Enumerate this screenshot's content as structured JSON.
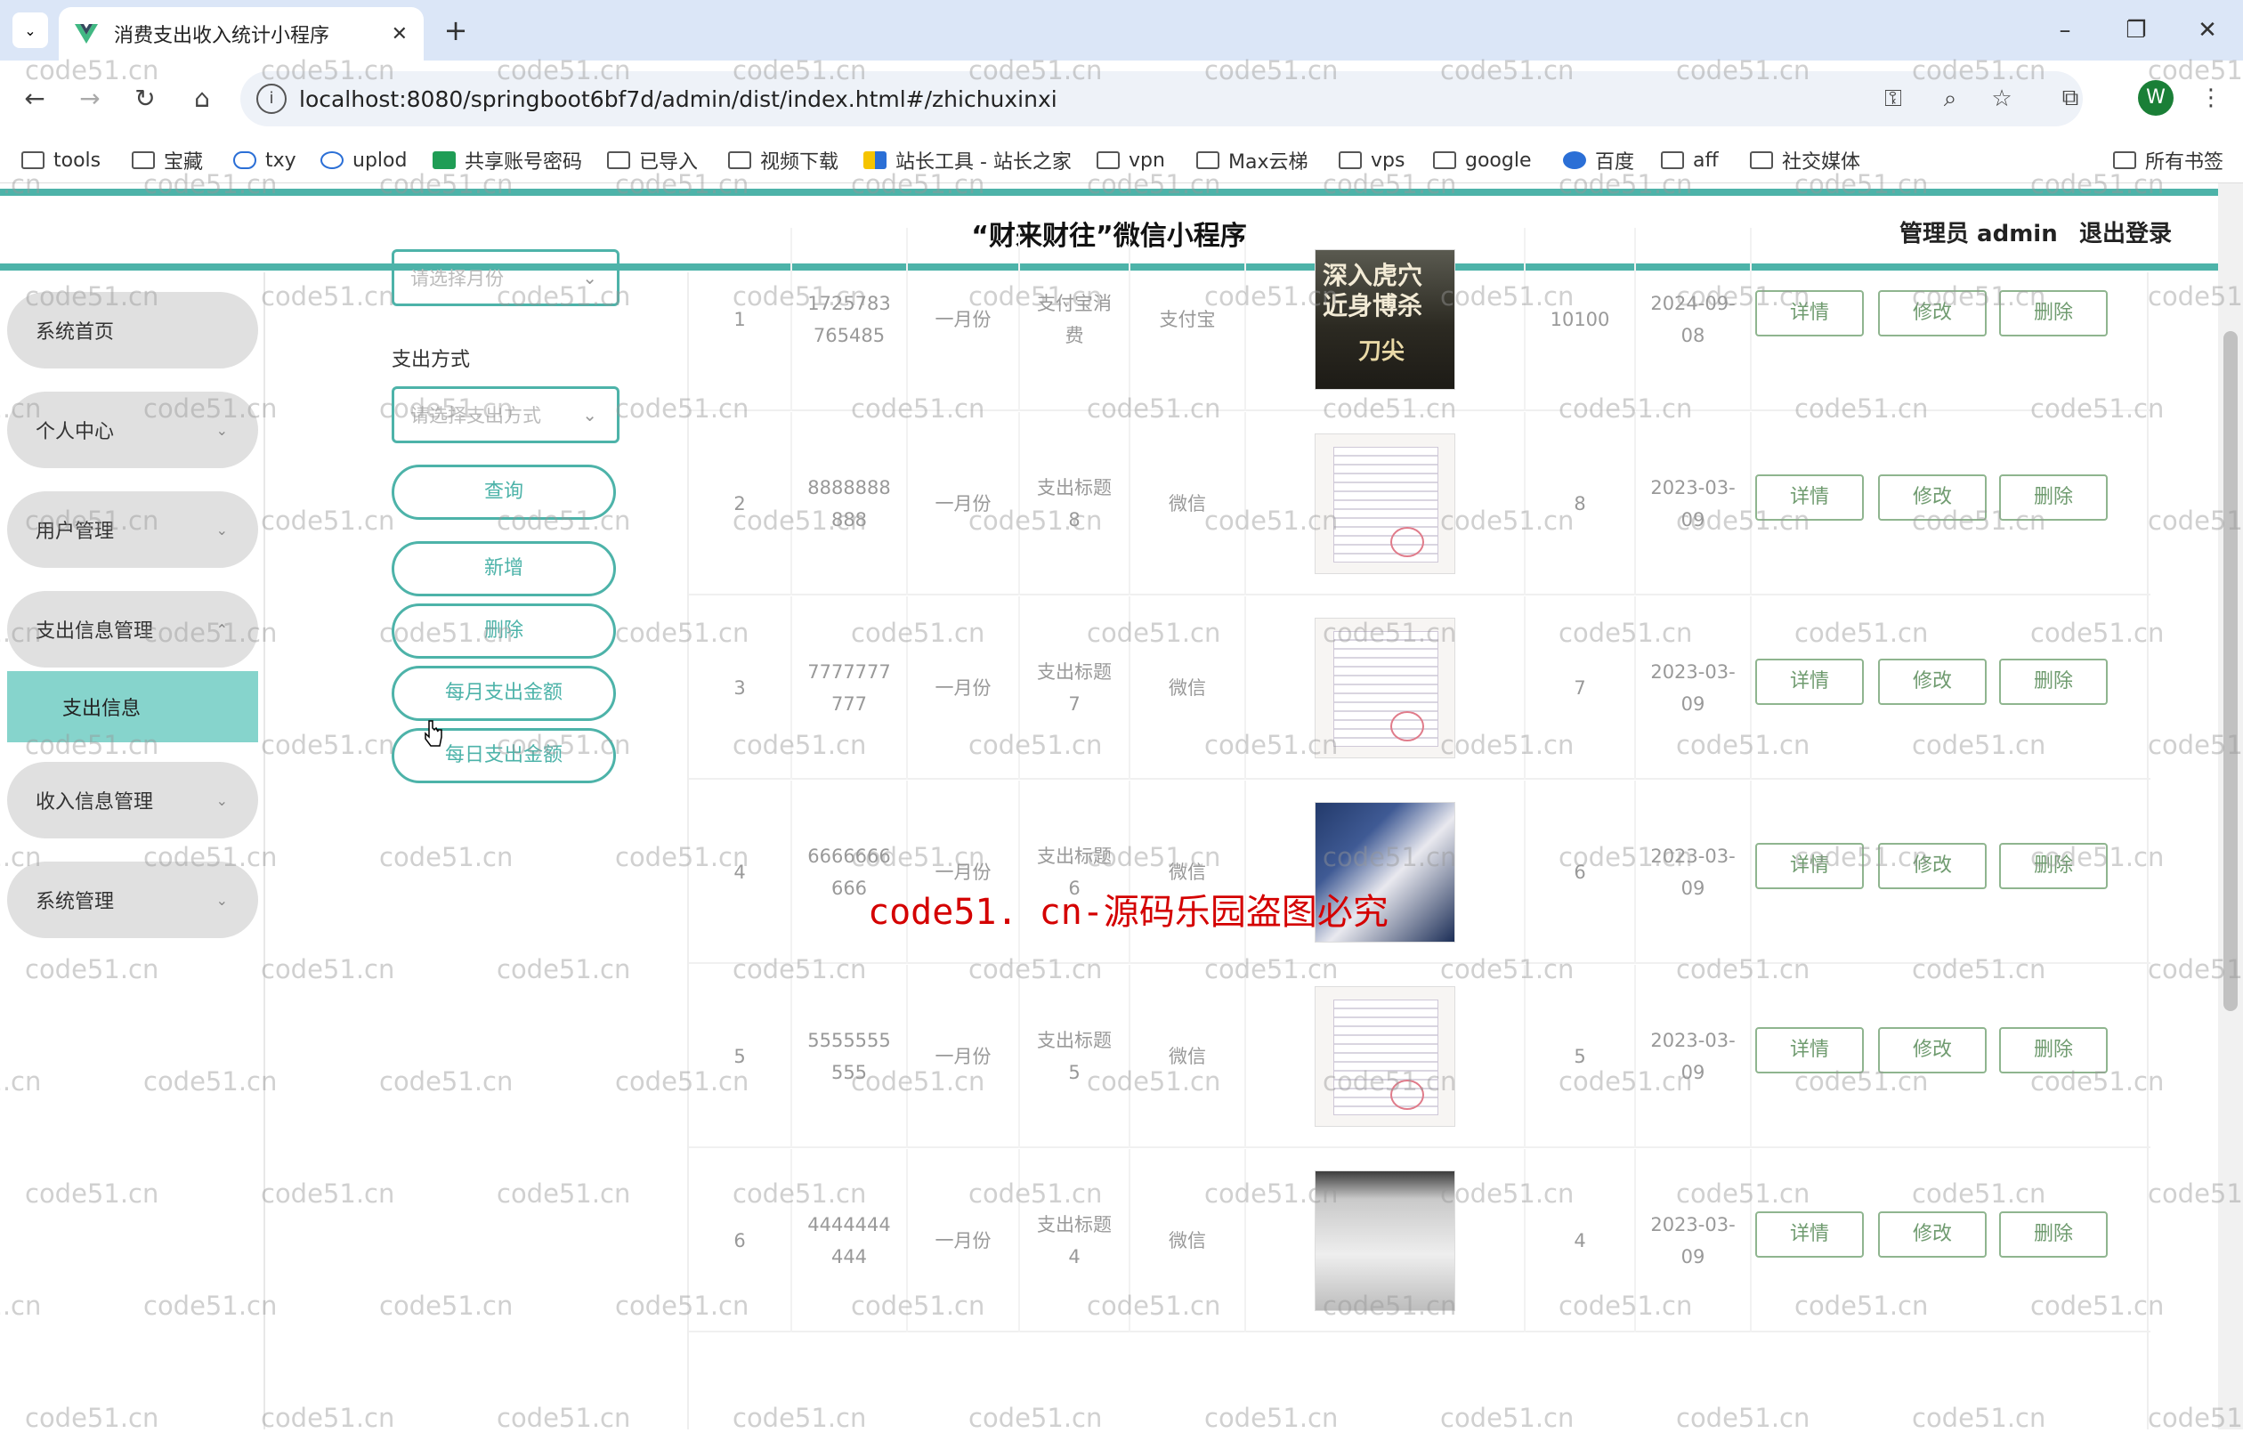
{
  "browser": {
    "tab_title": "消费支出收入统计小程序",
    "url": "localhost:8080/springboot6bf7d/admin/dist/index.html#/zhichuxinxi",
    "avatar_letter": "W",
    "bookmarks": [
      "tools",
      "宝藏",
      "txy",
      "uplod",
      "共享账号密码",
      "已导入",
      "视频下载",
      "站长工具 - 站长之家",
      "vpn",
      "Max云梯",
      "vps",
      "google",
      "百度",
      "aff",
      "社交媒体"
    ],
    "all_bookmarks": "所有书签"
  },
  "header": {
    "title": "“财来财往”微信小程序",
    "admin": "管理员 admin",
    "logout": "退出登录"
  },
  "sidebar": {
    "items": [
      {
        "label": "系统首页"
      },
      {
        "label": "个人中心"
      },
      {
        "label": "用户管理"
      },
      {
        "label": "支出信息管理"
      },
      {
        "label": "收入信息管理"
      },
      {
        "label": "系统管理"
      }
    ],
    "active_sub": "支出信息"
  },
  "filters": {
    "month_placeholder": "请选择月份",
    "method_label": "支出方式",
    "method_placeholder": "请选择支出方式",
    "query": "查询",
    "add": "新增",
    "delete": "删除",
    "monthly": "每月支出金额",
    "daily": "每日支出金额"
  },
  "actions": {
    "detail": "详情",
    "edit": "修改",
    "delete": "删除"
  },
  "rows": [
    {
      "idx": "1",
      "code": "1725783765485",
      "code_a": "1725783",
      "code_b": "765485",
      "month": "一月份",
      "title_a": "支付宝消",
      "title_b": "费",
      "method": "支付宝",
      "img": "poster",
      "amount": "10100",
      "date_a": "2024-09-",
      "date_b": "08"
    },
    {
      "idx": "2",
      "code": "8888888888",
      "code_a": "8888888",
      "code_b": "888",
      "month": "一月份",
      "title_a": "支出标题",
      "title_b": "8",
      "method": "微信",
      "img": "doc",
      "amount": "8",
      "date_a": "2023-03-",
      "date_b": "09"
    },
    {
      "idx": "3",
      "code": "7777777777",
      "code_a": "7777777",
      "code_b": "777",
      "month": "一月份",
      "title_a": "支出标题",
      "title_b": "7",
      "method": "微信",
      "img": "doc",
      "amount": "7",
      "date_a": "2023-03-",
      "date_b": "09"
    },
    {
      "idx": "4",
      "code": "6666666666",
      "code_a": "6666666",
      "code_b": "666",
      "month": "一月份",
      "title_a": "支出标题",
      "title_b": "6",
      "method": "微信",
      "img": "photo",
      "amount": "6",
      "date_a": "2023-03-",
      "date_b": "09"
    },
    {
      "idx": "5",
      "code": "5555555555",
      "code_a": "5555555",
      "code_b": "555",
      "month": "一月份",
      "title_a": "支出标题",
      "title_b": "5",
      "method": "微信",
      "img": "doc",
      "amount": "5",
      "date_a": "2023-03-",
      "date_b": "09"
    },
    {
      "idx": "6",
      "code": "4444444444",
      "code_a": "4444444",
      "code_b": "444",
      "month": "一月份",
      "title_a": "支出标题",
      "title_b": "4",
      "method": "微信",
      "img": "paper",
      "amount": "4",
      "date_a": "2023-03-",
      "date_b": "09"
    }
  ],
  "poster_text": {
    "line1": "深入虎穴",
    "line2": "近身博杀",
    "line3": "刀尖"
  },
  "watermark": {
    "center": "code51. cn-源码乐园盗图必究",
    "tile": "code51.cn"
  }
}
